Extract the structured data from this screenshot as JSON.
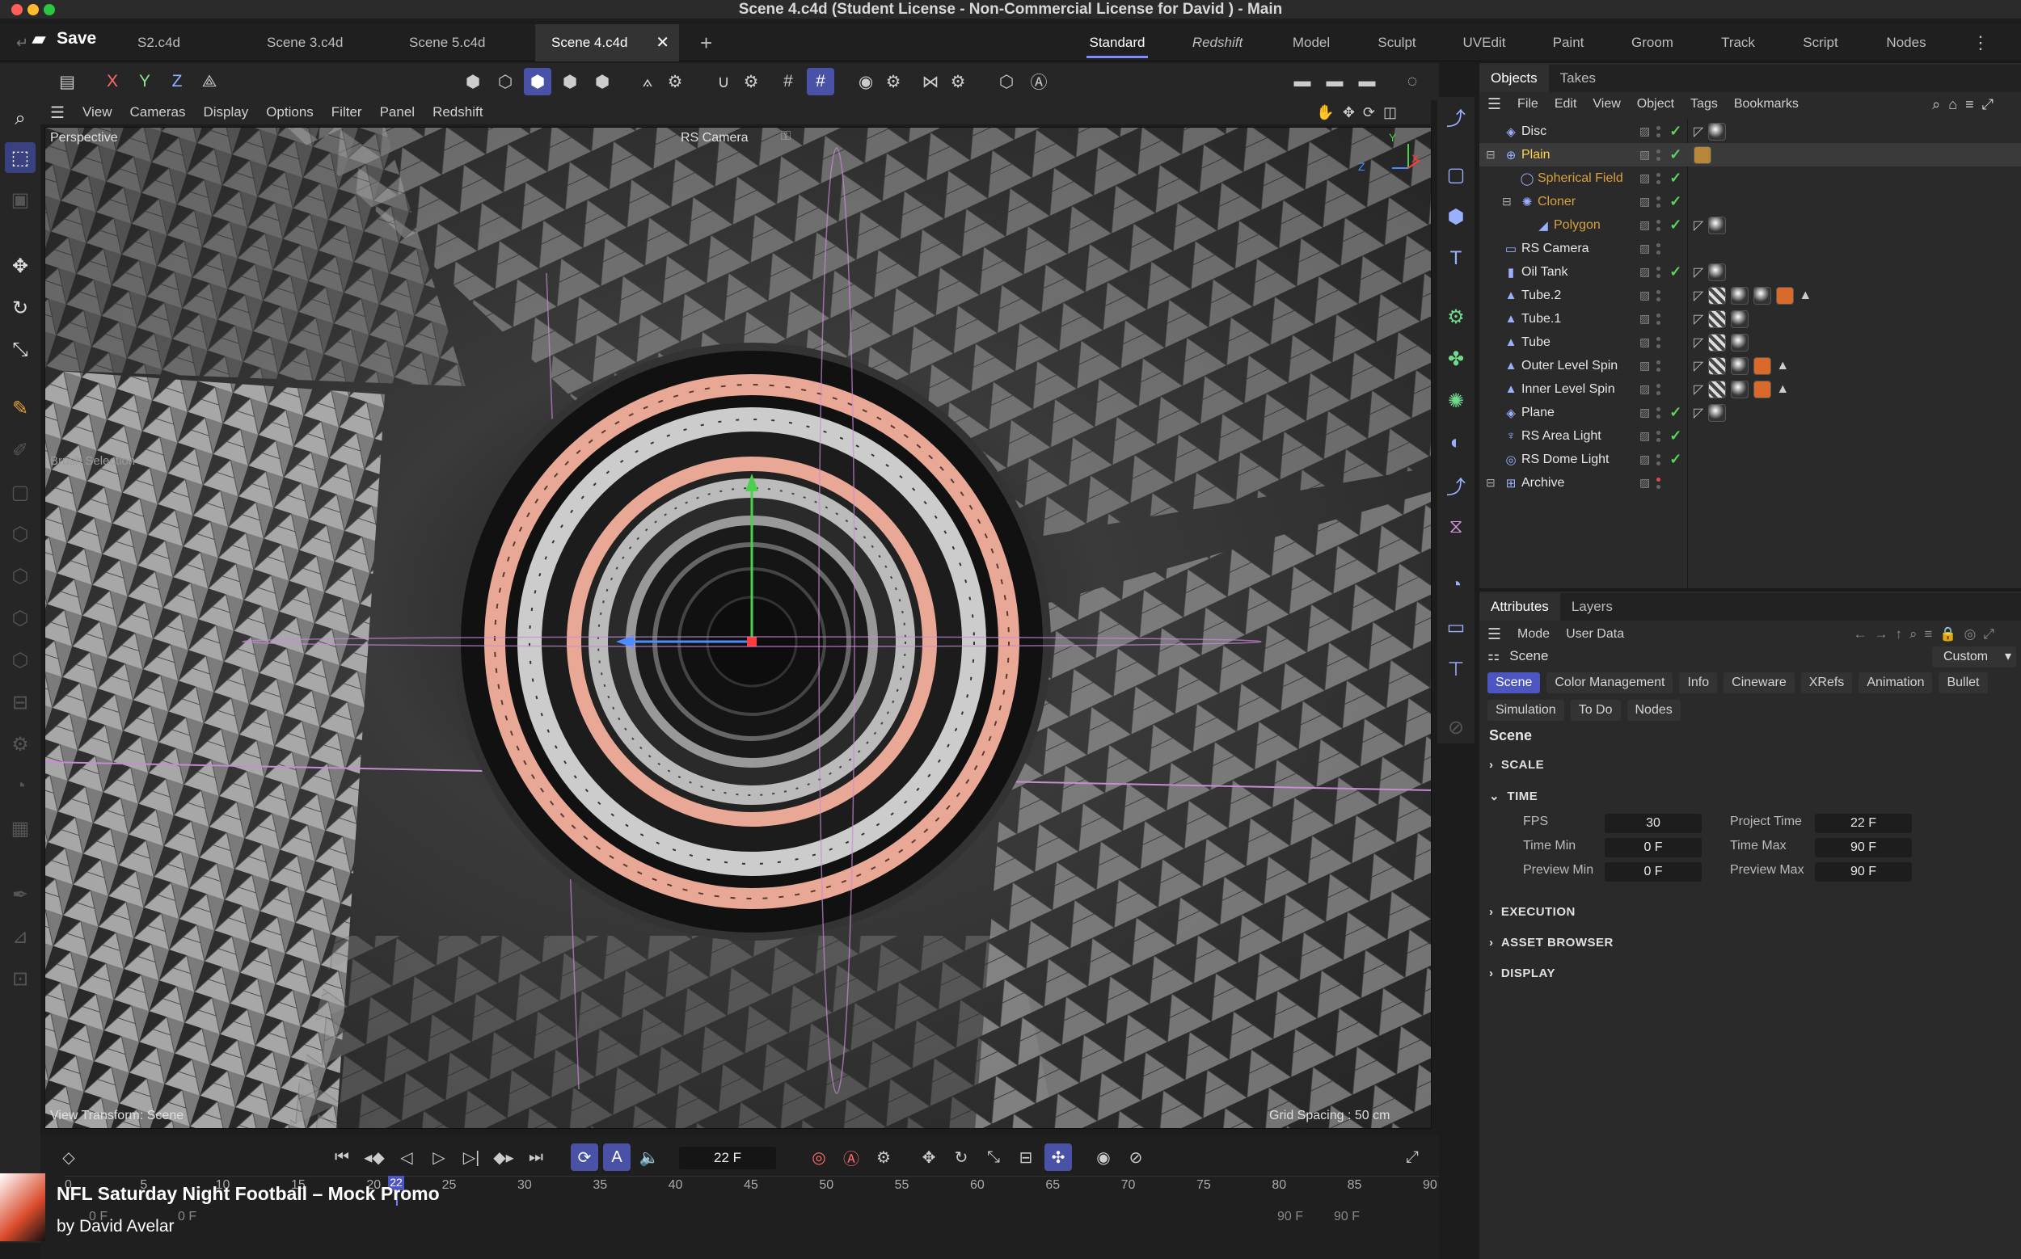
{
  "window": {
    "title": "Scene 4.c4d (Student License - Non-Commercial License for David ) - Main",
    "save_label": "Save"
  },
  "doc_tabs": [
    "S2.c4d",
    "Scene 3.c4d",
    "Scene 5.c4d",
    "Scene 4.c4d"
  ],
  "layout_tabs": [
    "Standard",
    "Redshift",
    "Model",
    "Sculpt",
    "UVEdit",
    "Paint",
    "Groom",
    "Track",
    "Script",
    "Nodes"
  ],
  "axis_toggles": [
    "X",
    "Y",
    "Z"
  ],
  "viewport": {
    "menu": [
      "View",
      "Cameras",
      "Display",
      "Options",
      "Filter",
      "Panel",
      "Redshift"
    ],
    "label": "Perspective",
    "camera": "RS Camera",
    "brush": "Brush Selection",
    "transform": "View Transform: Scene",
    "grid": "Grid Spacing : 50 cm",
    "axis_y": "Y",
    "axis_z": "Z",
    "axis_x": "X"
  },
  "right_panel": {
    "tabs": [
      "Objects",
      "Takes"
    ],
    "menu": [
      "File",
      "Edit",
      "View",
      "Object",
      "Tags",
      "Bookmarks"
    ]
  },
  "objects": [
    {
      "name": "Disc",
      "color": "#e6e6e6",
      "icon": "◈",
      "check": true
    },
    {
      "name": "Plain",
      "color": "#ffd34d",
      "icon": "⊕",
      "check": true
    },
    {
      "name": "Spherical Field",
      "color": "#d9a040",
      "icon": "◯",
      "check": true
    },
    {
      "name": "Cloner",
      "color": "#d9a040",
      "icon": "✺",
      "check": true
    },
    {
      "name": "Polygon",
      "color": "#d9a040",
      "icon": "◢",
      "check": true
    },
    {
      "name": "RS Camera",
      "color": "#e6e6e6",
      "icon": "▭",
      "check": false
    },
    {
      "name": "Oil Tank",
      "color": "#e6e6e6",
      "icon": "▮",
      "check": true
    },
    {
      "name": "Tube.2",
      "color": "#e6e6e6",
      "icon": "▲",
      "check": false
    },
    {
      "name": "Tube.1",
      "color": "#e6e6e6",
      "icon": "▲",
      "check": false
    },
    {
      "name": "Tube",
      "color": "#e6e6e6",
      "icon": "▲",
      "check": false
    },
    {
      "name": "Outer Level Spin",
      "color": "#e6e6e6",
      "icon": "▲",
      "check": false
    },
    {
      "name": "Inner Level Spin",
      "color": "#e6e6e6",
      "icon": "▲",
      "check": false
    },
    {
      "name": "Plane",
      "color": "#e6e6e6",
      "icon": "◈",
      "check": true
    },
    {
      "name": "RS Area Light",
      "color": "#e6e6e6",
      "icon": "♆",
      "check": true
    },
    {
      "name": "RS Dome Light",
      "color": "#e6e6e6",
      "icon": "◎",
      "check": true
    },
    {
      "name": "Archive",
      "color": "#e6e6e6",
      "icon": "⊞",
      "check": false
    }
  ],
  "attributes": {
    "tabs": [
      "Attributes",
      "Layers"
    ],
    "menu": [
      "Mode",
      "User Data"
    ],
    "object": "Scene",
    "preset": "Custom",
    "chips": [
      "Scene",
      "Color Management",
      "Info",
      "Cineware",
      "XRefs",
      "Animation",
      "Bullet",
      "Simulation",
      "To Do",
      "Nodes"
    ],
    "heading": "Scene",
    "sections": [
      "SCALE",
      "TIME",
      "EXECUTION",
      "ASSET BROWSER",
      "DISPLAY"
    ],
    "fields": {
      "fps_label": "FPS",
      "fps": "30",
      "ptime_label": "Project Time",
      "ptime": "22 F",
      "tmin_label": "Time Min",
      "tmin": "0 F",
      "tmax_label": "Time Max",
      "tmax": "90 F",
      "pmin_label": "Preview Min",
      "pmin": "0 F",
      "pmax_label": "Preview Max",
      "pmax": "90 F"
    }
  },
  "timeline": {
    "frame": "22 F",
    "ticks": [
      "0",
      "5",
      "10",
      "15",
      "20",
      "25",
      "30",
      "35",
      "40",
      "45",
      "50",
      "55",
      "60",
      "65",
      "70",
      "75",
      "80",
      "85",
      "90"
    ],
    "current_marker": "22",
    "range_left": "0 F",
    "range_left2": "0 F",
    "range_right": "90 F",
    "range_right2": "90 F"
  },
  "promo": {
    "title": "NFL Saturday Night Football – Mock Promo",
    "author": "by David Avelar"
  }
}
